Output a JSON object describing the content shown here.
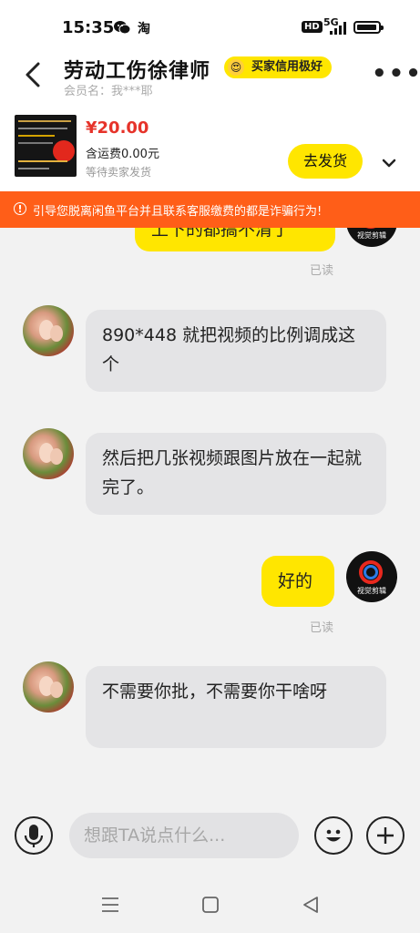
{
  "status_bar": {
    "time": "15:35",
    "app_icons": [
      "wechat-icon",
      "taobao-icon"
    ],
    "hd": "HD",
    "network": "5G"
  },
  "header": {
    "title": "劳动工伤徐律师",
    "credit_badge": "买家信用极好",
    "member_label": "会员名：我***耶"
  },
  "product": {
    "price": "¥20.00",
    "shipping": "含运费0.00元",
    "status": "等待卖家发货",
    "ship_button": "去发货"
  },
  "warning": {
    "text": "引导您脱离闲鱼平台并且联系客服缴费的都是诈骗行为!"
  },
  "messages": [
    {
      "from": "me",
      "text": "上下的都搞不清了",
      "read": "已读"
    },
    {
      "from": "partner",
      "text": "890*448 就把视频的比例调成这个"
    },
    {
      "from": "partner",
      "text": "然后把几张视频跟图片放在一起就完了。"
    },
    {
      "from": "me",
      "text": "好的",
      "read": "已读"
    },
    {
      "from": "partner",
      "text": "不需要你批，不需要你干啥呀"
    }
  ],
  "my_avatar_caption": "视觉剪辑",
  "input": {
    "placeholder": "想跟TA说点什么..."
  },
  "colors": {
    "accent_yellow": "#ffe600",
    "warning_orange": "#ff5e18",
    "price_red": "#e6332a"
  }
}
